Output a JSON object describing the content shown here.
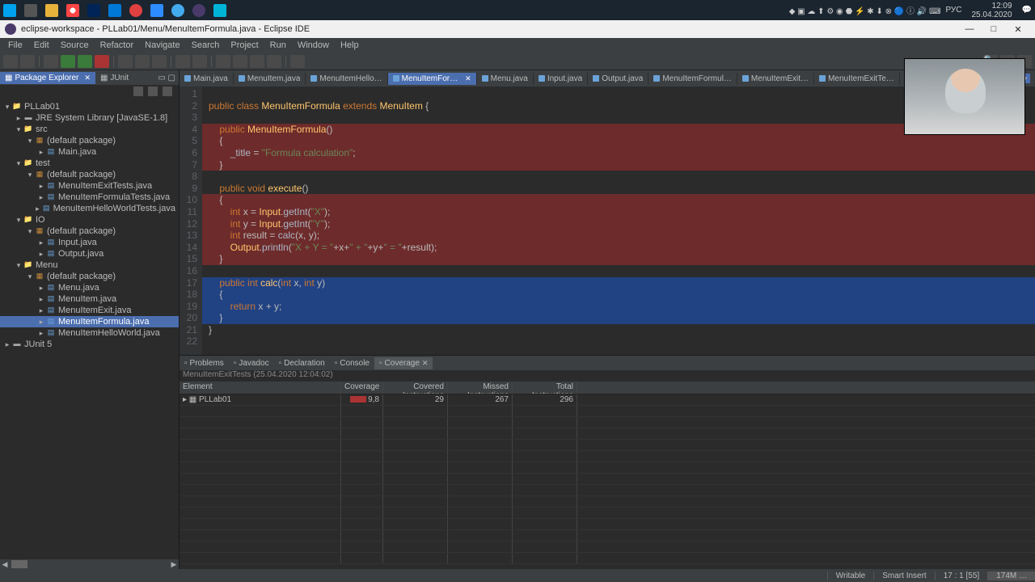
{
  "taskbar": {
    "time": "12:09",
    "date": "25.04.2020",
    "lang": "РУС"
  },
  "titlebar": {
    "title": "eclipse-workspace - PLLab01/Menu/MenuItemFormula.java - Eclipse IDE"
  },
  "menubar": [
    "File",
    "Edit",
    "Source",
    "Refactor",
    "Navigate",
    "Search",
    "Project",
    "Run",
    "Window",
    "Help"
  ],
  "sidebar": {
    "tabs": [
      {
        "label": "Package Explorer",
        "active": true
      },
      {
        "label": "JUnit",
        "active": false
      }
    ],
    "tree": [
      {
        "d": 0,
        "exp": "▾",
        "ico": "folder",
        "label": "PLLab01"
      },
      {
        "d": 1,
        "exp": "▸",
        "ico": "jar",
        "label": "JRE System Library [JavaSE-1.8]"
      },
      {
        "d": 1,
        "exp": "▾",
        "ico": "folder",
        "label": "src"
      },
      {
        "d": 2,
        "exp": "▾",
        "ico": "pkg",
        "label": "(default package)"
      },
      {
        "d": 3,
        "exp": "▸",
        "ico": "java",
        "label": "Main.java"
      },
      {
        "d": 1,
        "exp": "▾",
        "ico": "folder",
        "label": "test"
      },
      {
        "d": 2,
        "exp": "▾",
        "ico": "pkg",
        "label": "(default package)"
      },
      {
        "d": 3,
        "exp": "▸",
        "ico": "java",
        "label": "MenuItemExitTests.java"
      },
      {
        "d": 3,
        "exp": "▸",
        "ico": "java",
        "label": "MenuItemFormulaTests.java"
      },
      {
        "d": 3,
        "exp": "▸",
        "ico": "java",
        "label": "MenuItemHelloWorldTests.java"
      },
      {
        "d": 1,
        "exp": "▾",
        "ico": "folder",
        "label": "IO"
      },
      {
        "d": 2,
        "exp": "▾",
        "ico": "pkg",
        "label": "(default package)"
      },
      {
        "d": 3,
        "exp": "▸",
        "ico": "java",
        "label": "Input.java"
      },
      {
        "d": 3,
        "exp": "▸",
        "ico": "java",
        "label": "Output.java"
      },
      {
        "d": 1,
        "exp": "▾",
        "ico": "folder",
        "label": "Menu"
      },
      {
        "d": 2,
        "exp": "▾",
        "ico": "pkg",
        "label": "(default package)"
      },
      {
        "d": 3,
        "exp": "▸",
        "ico": "java",
        "label": "Menu.java"
      },
      {
        "d": 3,
        "exp": "▸",
        "ico": "java",
        "label": "MenuItem.java"
      },
      {
        "d": 3,
        "exp": "▸",
        "ico": "java",
        "label": "MenuItemExit.java"
      },
      {
        "d": 3,
        "exp": "▸",
        "ico": "java",
        "label": "MenuItemFormula.java",
        "selected": true
      },
      {
        "d": 3,
        "exp": "▸",
        "ico": "java",
        "label": "MenuItemHelloWorld.java"
      },
      {
        "d": 0,
        "exp": "▸",
        "ico": "jar",
        "label": "JUnit 5"
      }
    ]
  },
  "editor_tabs": [
    {
      "label": "Main.java"
    },
    {
      "label": "MenuItem.java"
    },
    {
      "label": "MenuItemHello…"
    },
    {
      "label": "MenuItemFormul…",
      "active": true
    },
    {
      "label": "Menu.java"
    },
    {
      "label": "Input.java"
    },
    {
      "label": "Output.java"
    },
    {
      "label": "MenuItemFormul…"
    },
    {
      "label": "MenuItemExit…"
    },
    {
      "label": "MenuItemExitTe…"
    }
  ],
  "code": {
    "lines": [
      {
        "n": 1,
        "hl": "",
        "html": ""
      },
      {
        "n": 2,
        "hl": "",
        "html": "<span class='kw'>public</span> <span class='kw'>class</span> <span class='fn'>MenuItemFormula</span> <span class='kw'>extends</span> <span class='fn'>MenuItem</span> {"
      },
      {
        "n": 3,
        "hl": "",
        "html": ""
      },
      {
        "n": 4,
        "hl": "red",
        "html": "    <span class='kw'>public</span> <span class='fn'>MenuItemFormula</span>()"
      },
      {
        "n": 5,
        "hl": "red",
        "html": "    {"
      },
      {
        "n": 6,
        "hl": "red",
        "html": "        <span class='id'>_title</span> = <span class='str'>\"Formula calculation\"</span>;"
      },
      {
        "n": 7,
        "hl": "red",
        "html": "    }"
      },
      {
        "n": 8,
        "hl": "",
        "html": ""
      },
      {
        "n": 9,
        "hl": "",
        "html": "    <span class='kw'>public</span> <span class='kw'>void</span> <span class='fn'>execute</span>()"
      },
      {
        "n": 10,
        "hl": "red",
        "html": "    {"
      },
      {
        "n": 11,
        "hl": "red",
        "html": "        <span class='kw'>int</span> x = <span class='fn'>Input</span>.<span class='id'>getInt</span>(<span class='str'>\"X\"</span>);"
      },
      {
        "n": 12,
        "hl": "red",
        "html": "        <span class='kw'>int</span> y = <span class='fn'>Input</span>.<span class='id'>getInt</span>(<span class='str'>\"Y\"</span>);"
      },
      {
        "n": 13,
        "hl": "red",
        "html": "        <span class='kw'>int</span> result = <span class='id'>calc</span>(x, y);"
      },
      {
        "n": 14,
        "hl": "red",
        "html": "        <span class='fn'>Output</span>.<span class='id'>println</span>(<span class='str'>\"X + Y = \"</span>+x+<span class='str'>\" + \"</span>+y+<span class='str'>\" = \"</span>+result);"
      },
      {
        "n": 15,
        "hl": "red",
        "html": "    }"
      },
      {
        "n": 16,
        "hl": "",
        "html": ""
      },
      {
        "n": 17,
        "hl": "blue",
        "html": "    <span class='kw'>public</span> <span class='kw'>int</span> <span class='fn'>calc</span>(<span class='kw'>int</span> x, <span class='kw'>int</span> y)"
      },
      {
        "n": 18,
        "hl": "blue",
        "html": "    {"
      },
      {
        "n": 19,
        "hl": "blue",
        "html": "        <span class='kw'>return</span> x + y;"
      },
      {
        "n": 20,
        "hl": "blue",
        "html": "    }"
      },
      {
        "n": 21,
        "hl": "",
        "html": "}"
      },
      {
        "n": 22,
        "hl": "",
        "html": ""
      }
    ]
  },
  "bottom": {
    "tabs": [
      {
        "label": "Problems"
      },
      {
        "label": "Javadoc"
      },
      {
        "label": "Declaration"
      },
      {
        "label": "Console"
      },
      {
        "label": "Coverage",
        "active": true
      }
    ],
    "session": "MenuItemExitTests (25.04.2020 12:04:02)",
    "headers": {
      "element": "Element",
      "coverage": "Coverage",
      "ci": "Covered Instructions",
      "mi": "Missed Instructions",
      "ti": "Total Instructions"
    },
    "rows": [
      {
        "element": "PLLab01",
        "coverage": "9,8 %",
        "ci": "29",
        "mi": "267",
        "ti": "296"
      }
    ]
  },
  "statusbar": {
    "writable": "Writable",
    "insert": "Smart Insert",
    "pos": "17 : 1 [55]",
    "mem": "174M …"
  }
}
